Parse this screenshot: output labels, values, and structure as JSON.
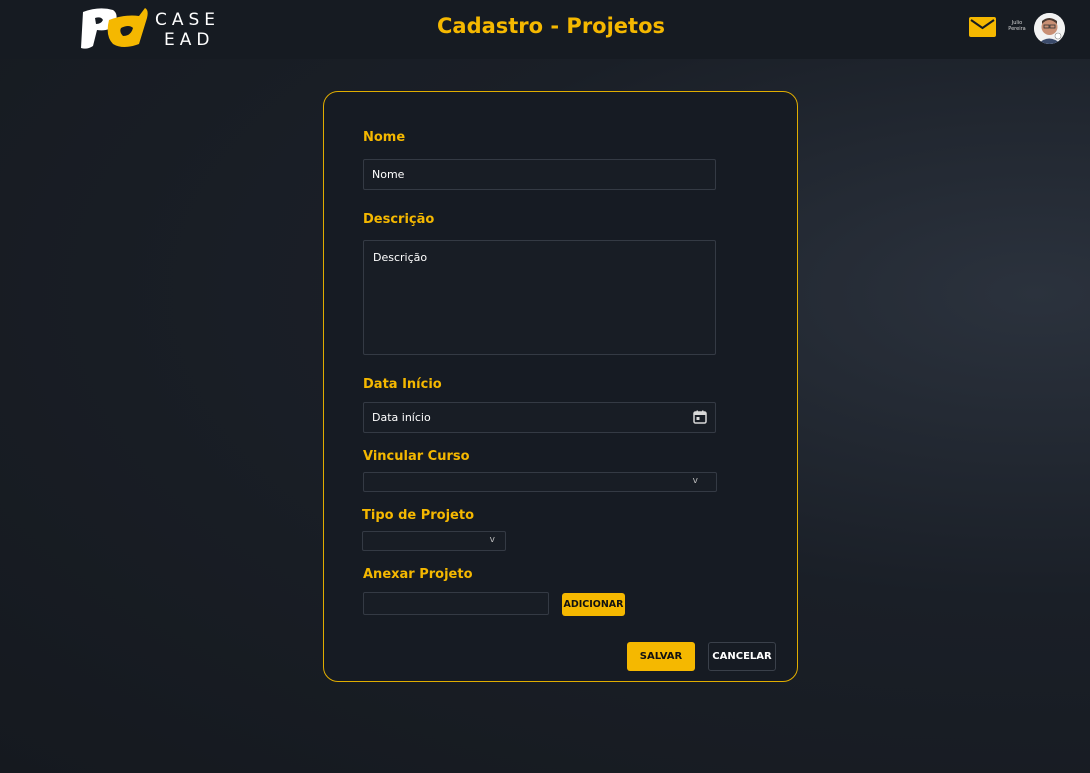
{
  "header": {
    "logo_line1": "CASE",
    "logo_line2": "EAD",
    "title": "Cadastro - Projetos",
    "user_first": "Julio",
    "user_last": "Pereira",
    "mail_icon": "mail-icon",
    "accent": "#f5b800"
  },
  "form": {
    "name_label": "Nome",
    "name_placeholder": "Nome",
    "description_label": "Descrição",
    "description_placeholder": "Descrição",
    "start_date_label": "Data Início",
    "start_date_placeholder": "Data início",
    "course_label": "Vincular Curso",
    "course_value": "",
    "project_type_label": "Tipo de Projeto",
    "project_type_value": "",
    "attach_label": "Anexar Projeto",
    "attach_value": "",
    "add_button": "ADICIONAR",
    "save_button": "SALVAR",
    "cancel_button": "CANCELAR",
    "chevron": "v"
  }
}
